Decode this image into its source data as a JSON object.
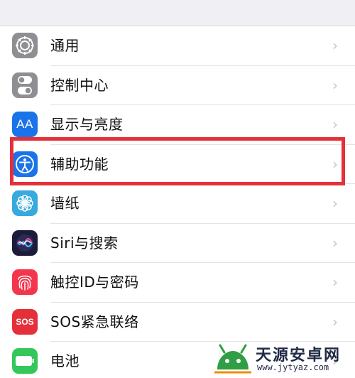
{
  "settings": {
    "items": [
      {
        "label": "通用",
        "icon": "gear-icon",
        "icon_color": "#8e8e93"
      },
      {
        "label": "控制中心",
        "icon": "toggle-switches-icon",
        "icon_color": "#8e8e93"
      },
      {
        "label": "显示与亮度",
        "icon": "text-size-icon",
        "icon_color": "#1a73e8",
        "icon_text": "AA"
      },
      {
        "label": "辅助功能",
        "icon": "accessibility-icon",
        "icon_color": "#1a73e8"
      },
      {
        "label": "墙纸",
        "icon": "flower-icon",
        "icon_color": "#36aadc"
      },
      {
        "label": "Siri与搜索",
        "icon": "siri-icon",
        "icon_color": "#1c1c3a"
      },
      {
        "label": "触控ID与密码",
        "icon": "fingerprint-icon",
        "icon_color": "#f4364c"
      },
      {
        "label": "SOS紧急联络",
        "icon": "sos-icon",
        "icon_color": "#e5303a",
        "icon_text": "SOS"
      },
      {
        "label": "电池",
        "icon": "battery-icon",
        "icon_color": "#34c759"
      }
    ],
    "chevron": "›",
    "highlighted_item": "辅助功能",
    "highlight_color": "#e5303a"
  },
  "watermark": {
    "title": "天源安卓网",
    "url": "www.jytyaz.com"
  }
}
